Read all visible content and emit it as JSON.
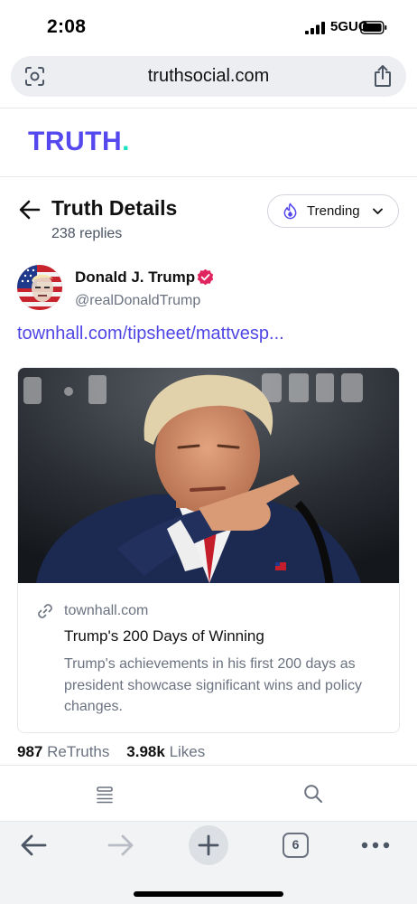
{
  "status_bar": {
    "time": "2:08",
    "network": "5GUC"
  },
  "browser": {
    "url": "truthsocial.com",
    "tabs_count": "6"
  },
  "brand": {
    "name": "TRUTH",
    "dot": ".",
    "color": "#5448ee",
    "dot_color": "#17e2c1"
  },
  "header": {
    "title": "Truth Details",
    "replies": "238 replies",
    "sort_label": "Trending"
  },
  "post": {
    "author_name": "Donald J. Trump",
    "author_handle": "@realDonaldTrump",
    "link_text": "townhall.com/tipsheet/mattvesp...",
    "card": {
      "domain": "townhall.com",
      "title": "Trump's 200 Days of Winning",
      "description": "Trump's achievements in his first 200 days as president showcase significant wins and policy changes."
    },
    "stats": {
      "retruths_count": "987",
      "retruths_label": "ReTruths",
      "likes_count": "3.98k",
      "likes_label": "Likes"
    }
  },
  "icons": {
    "url_left": "lens-icon",
    "share": "share-icon",
    "back": "back-arrow-icon",
    "trending": "flame-icon",
    "verified": "verified-badge-icon",
    "link": "link-icon",
    "feed": "feed-icon",
    "search": "search-icon"
  },
  "colors": {
    "link": "#4f46e5",
    "verified": "#e0245e"
  }
}
